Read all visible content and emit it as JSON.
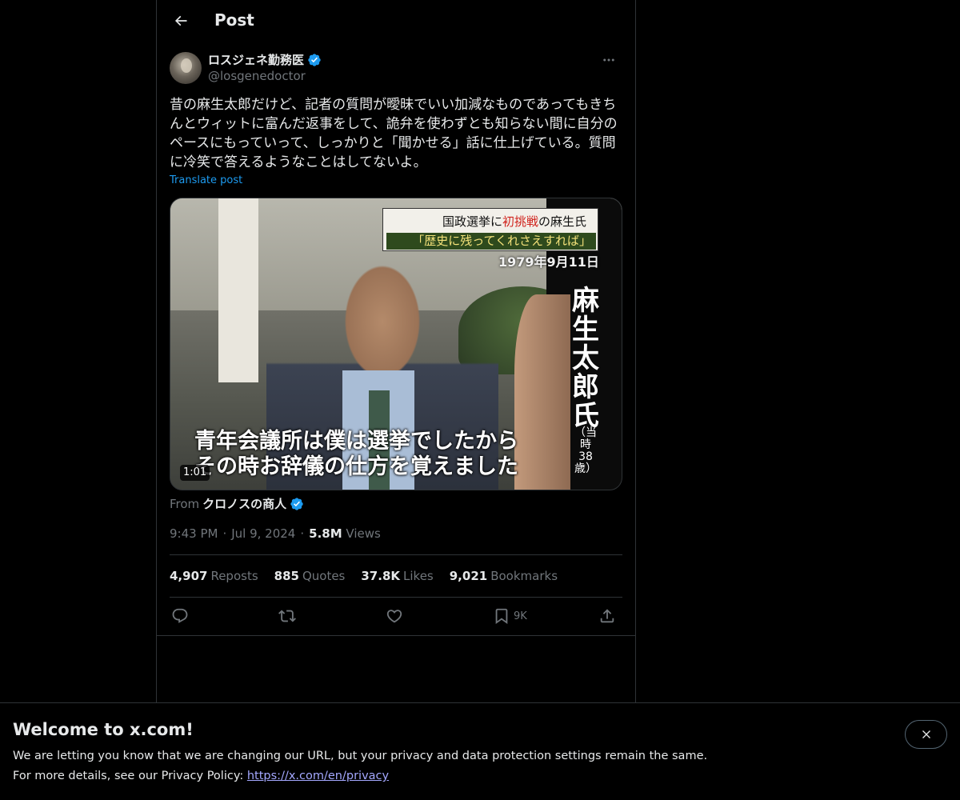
{
  "header": {
    "title": "Post"
  },
  "author": {
    "display_name": "ロスジェネ勤務医",
    "handle": "@losgenedoctor"
  },
  "post": {
    "text": "昔の麻生太郎だけど、記者の質問が曖昧でいい加減なものであってもきちんとウィットに富んだ返事をして、詭弁を使わずとも知らない間に自分のペースにもっていって、しっかりと「聞かせる」話に仕上げている。質問に冷笑で答えるようなことはしてないよ。",
    "translate_label": "Translate post"
  },
  "media": {
    "caption_top_prefix": "国政選挙に",
    "caption_top_highlight": "初挑戦",
    "caption_top_suffix": "の麻生氏",
    "caption_quote": "「歴史に残ってくれさえすれば」",
    "caption_date": "1979年9月11日",
    "name_vertical": "麻生太郎氏",
    "age_vertical": "（当時38歳）",
    "subtitle_line1": "青年会議所は僕は選挙でしたから",
    "subtitle_line2": "その時お辞儀の仕方を覚えました",
    "duration": "1:01"
  },
  "source": {
    "from_label": "From",
    "name": "クロノスの商人"
  },
  "meta": {
    "time": "9:43 PM",
    "date": "Jul 9, 2024",
    "views_count": "5.8M",
    "views_label": "Views"
  },
  "stats": {
    "reposts_count": "4,907",
    "reposts_label": "Reposts",
    "quotes_count": "885",
    "quotes_label": "Quotes",
    "likes_count": "37.8K",
    "likes_label": "Likes",
    "bookmarks_count": "9,021",
    "bookmarks_label": "Bookmarks"
  },
  "actions": {
    "bookmark_count": "9K"
  },
  "banner": {
    "title": "Welcome to x.com!",
    "text1": "We are letting you know that we are changing our URL, but your privacy and data protection settings remain the same.",
    "text2_prefix": "For more details, see our Privacy Policy: ",
    "link": "https://x.com/en/privacy"
  },
  "colors": {
    "background": "#000000",
    "text_primary": "#e7e9ea",
    "text_secondary": "#71767b",
    "accent": "#1d9bf0",
    "border": "#2f3336"
  }
}
